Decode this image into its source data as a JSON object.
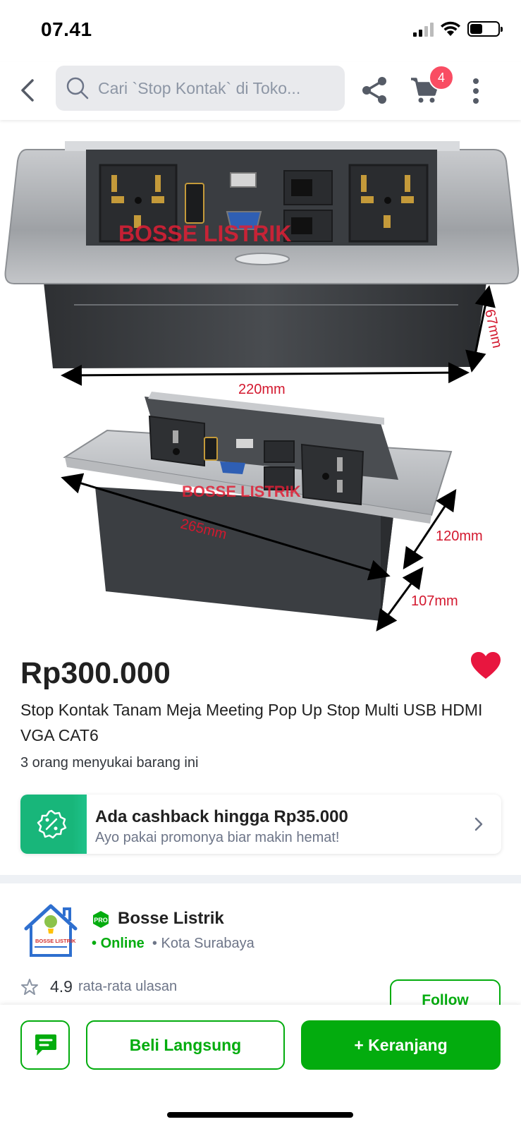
{
  "status_bar": {
    "time": "07.41"
  },
  "nav": {
    "search_placeholder": "Cari `Stop Kontak` di Toko...",
    "cart_count": "4"
  },
  "product": {
    "watermark": "BOSSE LISTRIK",
    "dimensions": {
      "top_width": "220mm",
      "top_height": "67mm",
      "bottom_length": "265mm",
      "bottom_depth": "120mm",
      "bottom_height": "107mm"
    },
    "price": "Rp300.000",
    "title": "Stop Kontak Tanam Meja Meeting Pop Up Stop Multi USB HDMI VGA CAT6",
    "likes": "3 orang menyukai barang ini"
  },
  "cashback": {
    "title": "Ada cashback hingga Rp35.000",
    "subtitle": "Ayo pakai promonya biar makin hemat!"
  },
  "shop": {
    "logo_text": "BOSSE LISTRIK",
    "badge": "PRO",
    "name": "Bosse Listrik",
    "status": "Online",
    "location": "Kota Surabaya",
    "rating": "4.9",
    "rating_label": "rata-rata ulasan",
    "follow_label": "Follow"
  },
  "actions": {
    "buy_now": "Beli Langsung",
    "add_to_cart": "+ Keranjang"
  },
  "colors": {
    "primary_green": "#03ac0e",
    "badge_red": "#f94d63",
    "wishlist_red": "#e8163f",
    "cashback_green": "#18b67a"
  }
}
